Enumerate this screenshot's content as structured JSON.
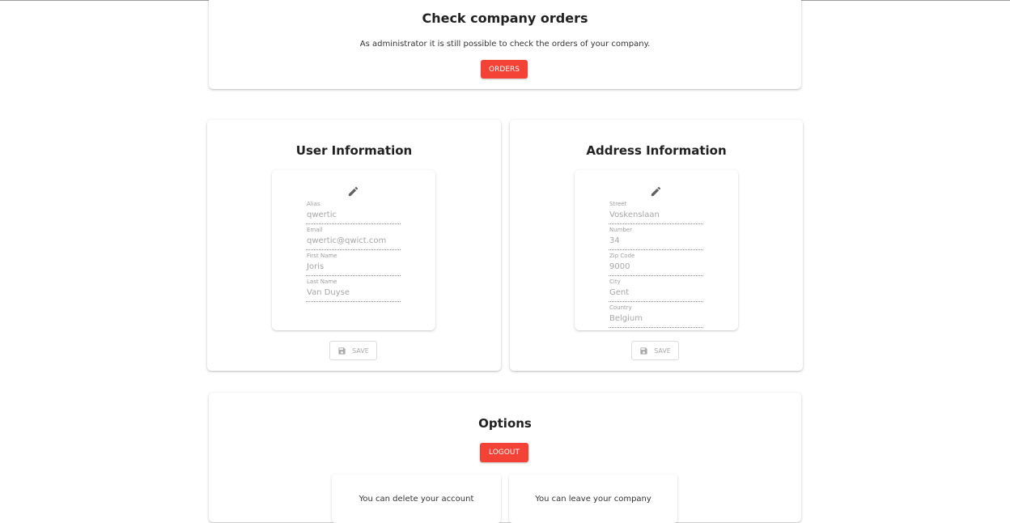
{
  "orders_section": {
    "title": "Check company orders",
    "description": "As administrator it is still possible to check the orders of your company.",
    "button_label": "ORDERS"
  },
  "user_info": {
    "title": "User Information",
    "fields": [
      {
        "label": "Alias",
        "value": "qwertic"
      },
      {
        "label": "Email",
        "value": "qwertic@qwict.com"
      },
      {
        "label": "First Name",
        "value": "Joris"
      },
      {
        "label": "Last Name",
        "value": "Van Duyse"
      }
    ],
    "save_label": "SAVE"
  },
  "address_info": {
    "title": "Address Information",
    "fields": [
      {
        "label": "Street",
        "value": "Voskenslaan"
      },
      {
        "label": "Number",
        "value": "34"
      },
      {
        "label": "Zip Code",
        "value": "9000"
      },
      {
        "label": "City",
        "value": "Gent"
      },
      {
        "label": "Country",
        "value": "Belgium"
      }
    ],
    "save_label": "SAVE"
  },
  "options": {
    "title": "Options",
    "logout_label": "LOGOUT",
    "delete_text": "You can delete your account",
    "leave_text": "You can leave your company"
  },
  "colors": {
    "accent_red": "#f44336",
    "icon_gray": "#616161",
    "disabled_gray": "#aaaaaa"
  },
  "icons": {
    "edit": "pencil-icon",
    "save": "floppy-disk-icon"
  }
}
